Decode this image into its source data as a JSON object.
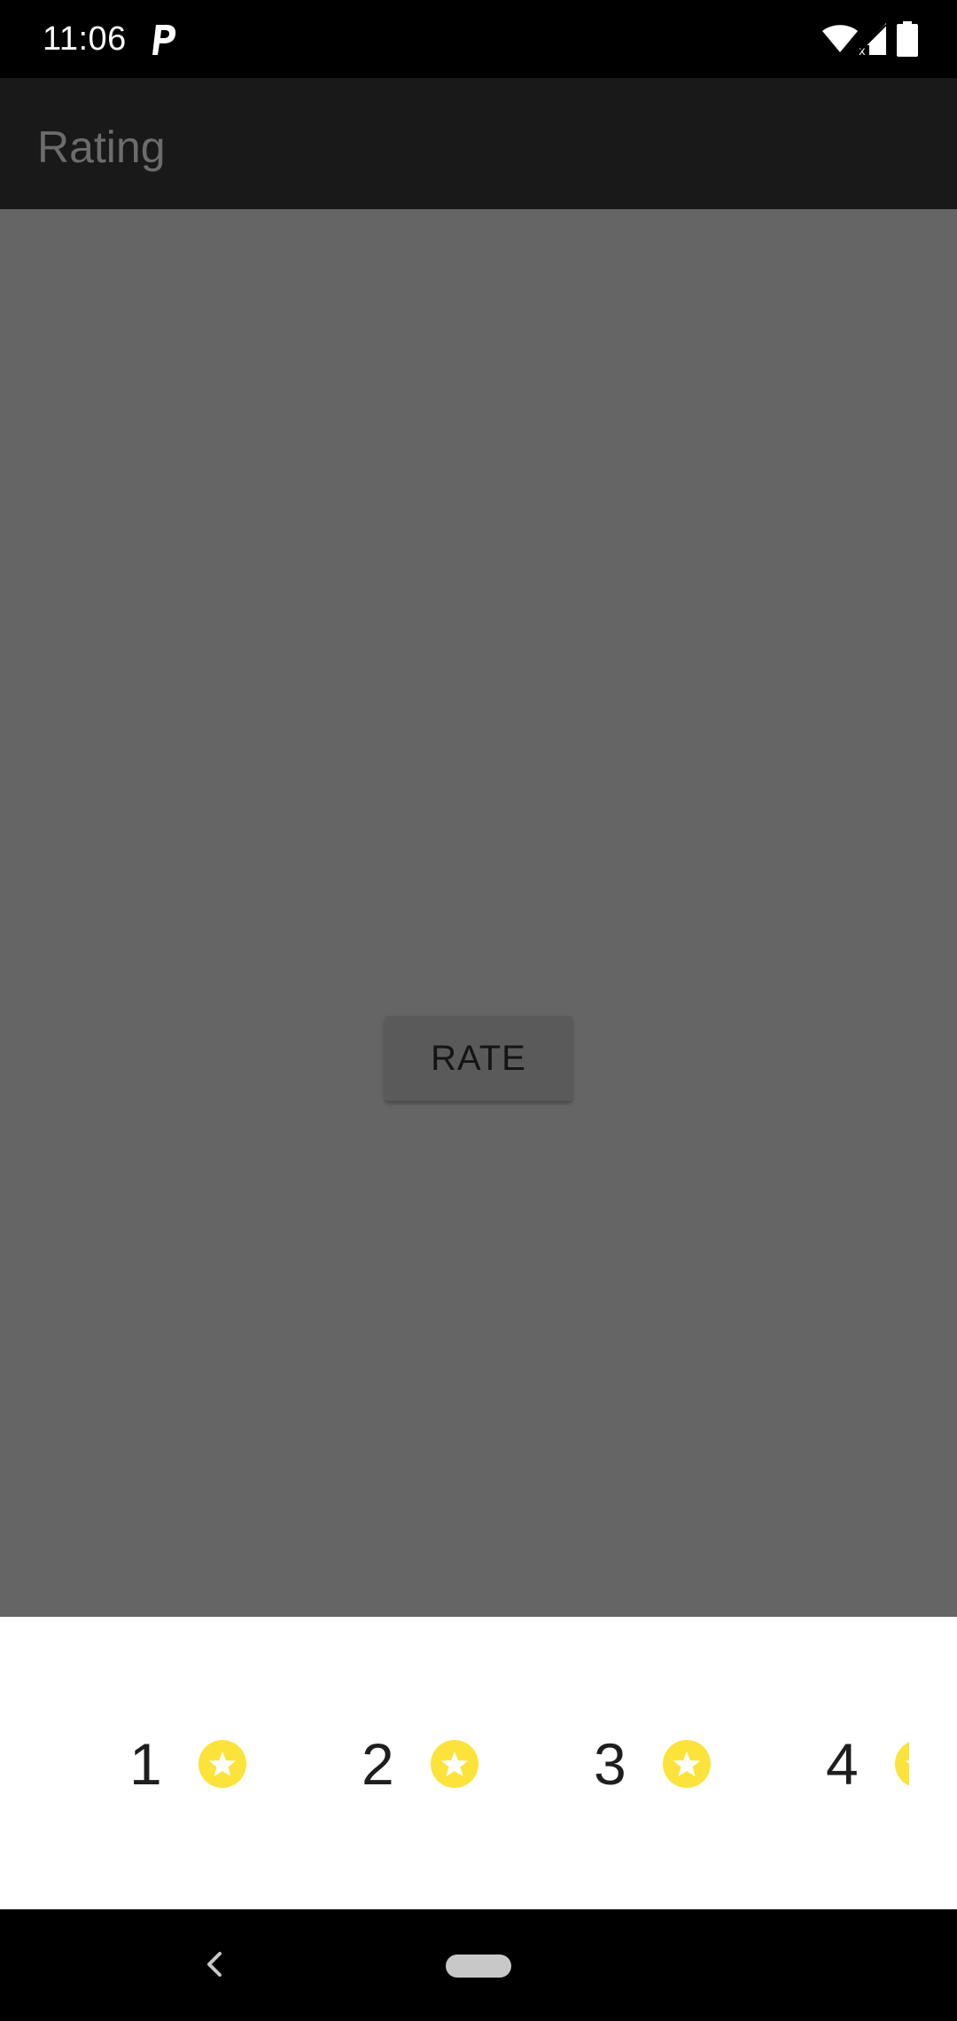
{
  "status_bar": {
    "time": "11:06",
    "icons": [
      "parking-icon",
      "wifi-icon",
      "signal-icon",
      "battery-icon"
    ]
  },
  "app_bar": {
    "title": "Rating"
  },
  "main": {
    "rate_button_label": "RATE"
  },
  "rating_sheet": {
    "options": [
      {
        "value": "1",
        "icon": "star-icon"
      },
      {
        "value": "2",
        "icon": "star-icon"
      },
      {
        "value": "3",
        "icon": "star-icon"
      },
      {
        "value": "4",
        "icon": "star-icon"
      }
    ],
    "star_color": "#fbe33b"
  },
  "nav_bar": {
    "icons": [
      "back-icon",
      "home-pill-icon"
    ]
  }
}
